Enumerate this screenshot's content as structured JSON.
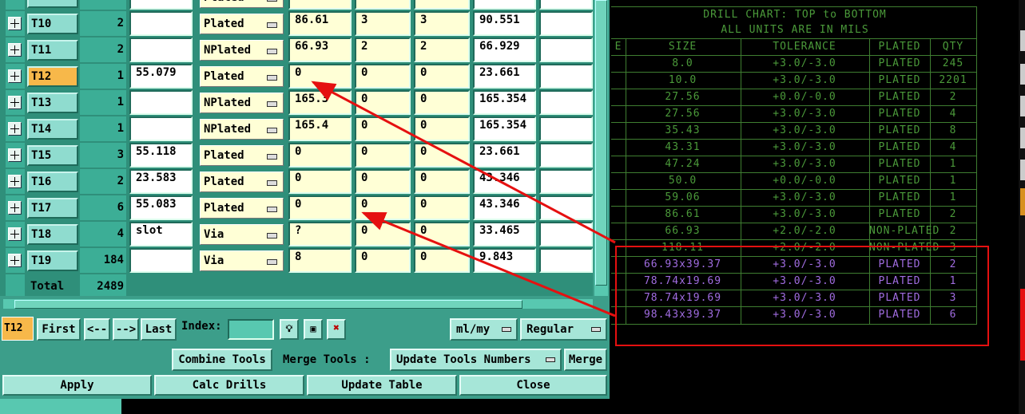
{
  "tool_table": {
    "partial_top_row": {
      "type": "Plated"
    },
    "rows": [
      {
        "name": "T10",
        "count": "2",
        "diameter": "",
        "type": "Plated",
        "f1": "86.61",
        "f2": "3",
        "f3": "3",
        "f4": "90.551",
        "f5": "",
        "selected": false
      },
      {
        "name": "T11",
        "count": "2",
        "diameter": "",
        "type": "NPlated",
        "f1": "66.93",
        "f2": "2",
        "f3": "2",
        "f4": "66.929",
        "f5": "",
        "selected": false
      },
      {
        "name": "T12",
        "count": "1",
        "diameter": "55.079",
        "type": "Plated",
        "f1": "0",
        "f2": "0",
        "f3": "0",
        "f4": "23.661",
        "f5": "",
        "selected": true
      },
      {
        "name": "T13",
        "count": "1",
        "diameter": "",
        "type": "NPlated",
        "f1": "165.3",
        "f2": "0",
        "f3": "0",
        "f4": "165.354",
        "f5": "",
        "selected": false
      },
      {
        "name": "T14",
        "count": "1",
        "diameter": "",
        "type": "NPlated",
        "f1": "165.4",
        "f2": "0",
        "f3": "0",
        "f4": "165.354",
        "f5": "",
        "selected": false
      },
      {
        "name": "T15",
        "count": "3",
        "diameter": "55.118",
        "type": "Plated",
        "f1": "0",
        "f2": "0",
        "f3": "0",
        "f4": "23.661",
        "f5": "",
        "selected": false
      },
      {
        "name": "T16",
        "count": "2",
        "diameter": "23.583",
        "type": "Plated",
        "f1": "0",
        "f2": "0",
        "f3": "0",
        "f4": "43.346",
        "f5": "",
        "selected": false
      },
      {
        "name": "T17",
        "count": "6",
        "diameter": "55.083",
        "type": "Plated",
        "f1": "0",
        "f2": "0",
        "f3": "0",
        "f4": "43.346",
        "f5": "",
        "selected": false
      },
      {
        "name": "T18",
        "count": "4",
        "diameter": "slot",
        "type": "Via",
        "f1": "?",
        "f2": "0",
        "f3": "0",
        "f4": "33.465",
        "f5": "",
        "selected": false
      },
      {
        "name": "T19",
        "count": "184",
        "diameter": "",
        "type": "Via",
        "f1": "8",
        "f2": "0",
        "f3": "0",
        "f4": "9.843",
        "f5": "",
        "selected": false
      }
    ],
    "total_label": "Total",
    "total_value": "2489"
  },
  "nav": {
    "current_tool": "T12",
    "first": "First",
    "prev": "<--",
    "next": "-->",
    "last": "Last",
    "index_label": "Index:",
    "index_value": "",
    "units": "ml/my",
    "mode": "Regular"
  },
  "actions": {
    "combine": "Combine Tools",
    "merge_label": "Merge Tools :",
    "merge_option": "Update Tools Numbers",
    "merge": "Merge",
    "apply": "Apply",
    "calc": "Calc Drills",
    "update": "Update Table",
    "close": "Close"
  },
  "drill_chart": {
    "title1": "DRILL CHART: TOP to BOTTOM",
    "title2": "ALL UNITS ARE IN MILS",
    "headers": [
      "E",
      "SIZE",
      "TOLERANCE",
      "PLATED",
      "QTY"
    ],
    "rows": [
      {
        "size": "8.0",
        "tol": "+3.0/-3.0",
        "plated": "PLATED",
        "qty": "245",
        "slot": false
      },
      {
        "size": "10.0",
        "tol": "+3.0/-3.0",
        "plated": "PLATED",
        "qty": "2201",
        "slot": false
      },
      {
        "size": "27.56",
        "tol": "+0.0/-0.0",
        "plated": "PLATED",
        "qty": "2",
        "slot": false
      },
      {
        "size": "27.56",
        "tol": "+3.0/-3.0",
        "plated": "PLATED",
        "qty": "4",
        "slot": false
      },
      {
        "size": "35.43",
        "tol": "+3.0/-3.0",
        "plated": "PLATED",
        "qty": "8",
        "slot": false
      },
      {
        "size": "43.31",
        "tol": "+3.0/-3.0",
        "plated": "PLATED",
        "qty": "4",
        "slot": false
      },
      {
        "size": "47.24",
        "tol": "+3.0/-3.0",
        "plated": "PLATED",
        "qty": "1",
        "slot": false
      },
      {
        "size": "50.0",
        "tol": "+0.0/-0.0",
        "plated": "PLATED",
        "qty": "1",
        "slot": false
      },
      {
        "size": "59.06",
        "tol": "+3.0/-3.0",
        "plated": "PLATED",
        "qty": "1",
        "slot": false
      },
      {
        "size": "86.61",
        "tol": "+3.0/-3.0",
        "plated": "PLATED",
        "qty": "2",
        "slot": false
      },
      {
        "size": "66.93",
        "tol": "+2.0/-2.0",
        "plated": "NON-PLATED",
        "qty": "2",
        "slot": false
      },
      {
        "size": "118.11",
        "tol": "+2.0/-2.0",
        "plated": "NON-PLATED",
        "qty": "3",
        "slot": false
      },
      {
        "size": "66.93x39.37",
        "tol": "+3.0/-3.0",
        "plated": "PLATED",
        "qty": "2",
        "slot": true
      },
      {
        "size": "78.74x19.69",
        "tol": "+3.0/-3.0",
        "plated": "PLATED",
        "qty": "1",
        "slot": true
      },
      {
        "size": "78.74x19.69",
        "tol": "+3.0/-3.0",
        "plated": "PLATED",
        "qty": "3",
        "slot": true
      },
      {
        "size": "98.43x39.37",
        "tol": "+3.0/-3.0",
        "plated": "PLATED",
        "qty": "6",
        "slot": true
      }
    ]
  },
  "colors": {
    "panel": "#3c9e8a",
    "selected": "#f7b84a",
    "chart_green": "#4b9a3a",
    "chart_purple": "#a06ce0",
    "annotation_red": "#e51010"
  }
}
